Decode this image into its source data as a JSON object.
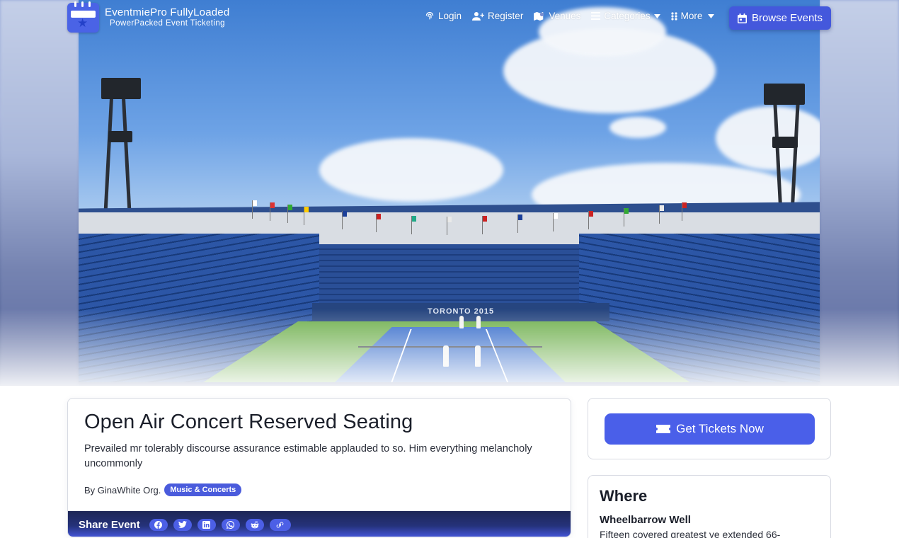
{
  "brand": {
    "name": "EventmiePro FullyLoaded",
    "tagline": "PowerPacked Event Ticketing"
  },
  "nav": {
    "login": "Login",
    "register": "Register",
    "venues": "Venues",
    "categories": "Categories",
    "more": "More",
    "browse_events": "Browse Events"
  },
  "hero": {
    "banner_text": "TORONTO 2015",
    "icon": "stadium-photo"
  },
  "event": {
    "title": "Open Air Concert Reserved Seating",
    "description": "Prevailed mr tolerably discourse assurance estimable applauded to so. Him everything melancholy uncommonly",
    "by": "By GinaWhite Org.",
    "category": "Music & Concerts",
    "share_label": "Share Event",
    "share_icons": [
      "facebook-icon",
      "twitter-icon",
      "linkedin-icon",
      "whatsapp-icon",
      "reddit-icon",
      "link-icon"
    ]
  },
  "tickets": {
    "button_label": "Get Tickets Now"
  },
  "where": {
    "title": "Where",
    "venue_name": "Wheelbarrow Well",
    "venue_address": "Fifteen covered greatest ye extended 66-"
  },
  "colors": {
    "accent": "#4a5fe9",
    "share_bar_start": "#1d2656",
    "share_bar_end": "#4759e0"
  }
}
